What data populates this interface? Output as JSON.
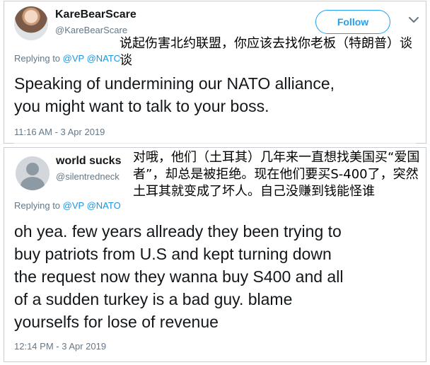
{
  "tweets": [
    {
      "display_name": "KareBearScare",
      "handle": "@KareBearScare",
      "follow_label": "Follow",
      "avatar_icon": "user-photo",
      "replying_to_prefix": "Replying to ",
      "mentions": [
        "@VP",
        "@NATO"
      ],
      "translation": "说起伤害北约联盟，你应该去找你老板（特朗普）谈谈",
      "text_lines": [
        "Speaking of undermining our NATO alliance,",
        "you might want to talk to your boss."
      ],
      "timestamp": "11:16 AM - 3 Apr 2019"
    },
    {
      "display_name": "world sucks",
      "handle": "@silentredneck",
      "avatar_icon": "default-user-icon",
      "replying_to_prefix": "Replying to ",
      "mentions": [
        "@VP",
        "@NATO"
      ],
      "translation": "对哦，他们（土耳其）几年来一直想找美国买“爱国者”，却总是被拒绝。现在他们要买S-400了，突然土耳其就变成了坏人。自己没赚到钱能怪谁",
      "text_lines": [
        "oh yea. few years allready they been trying to",
        "buy patriots from U.S and kept turning down",
        "the request now they wanna buy S400 and all",
        "of a sudden turkey is a bad guy. blame",
        "yourselfs for lose of revenue"
      ],
      "timestamp": "12:14 PM - 3 Apr 2019"
    }
  ],
  "colors": {
    "accent": "#1da1f2",
    "mention": "#1b95e0",
    "muted": "#657786",
    "text": "#14171a",
    "border": "#c8ced3"
  }
}
